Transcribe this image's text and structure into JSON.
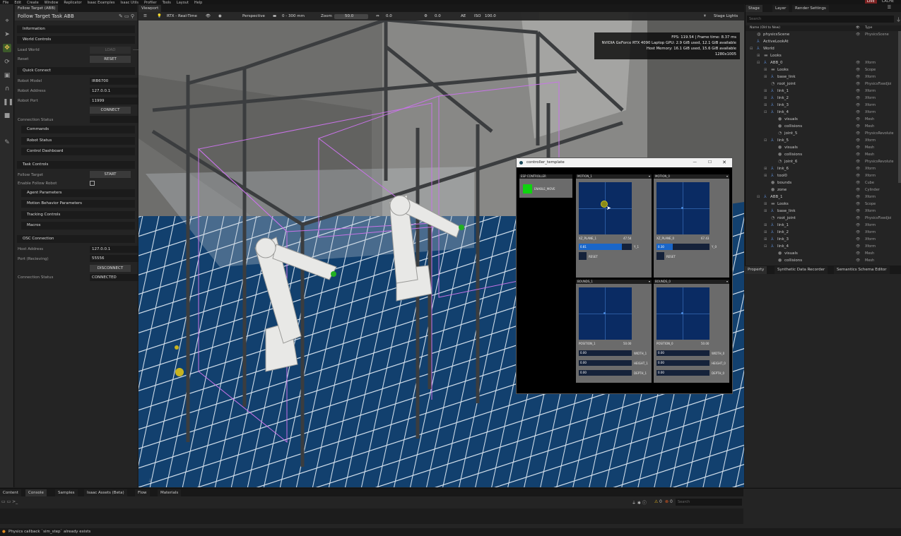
{
  "menu": [
    "File",
    "Edit",
    "Create",
    "Window",
    "Replicator",
    "Isaac Examples",
    "Isaac Utils",
    "Profiler",
    "Tools",
    "Layout",
    "Help"
  ],
  "menu_right": {
    "live": "LIVE",
    "cache": "CACHE"
  },
  "left_panel": {
    "tab": "Follow Target (ABB)",
    "title": "Follow Target Task ABB",
    "sections": {
      "information": "Information",
      "world_controls": "World Controls",
      "quick_connect": "Quick Connect",
      "commands": "Commands",
      "robot_status": "Robot Status",
      "control_dashboard": "Control Dashboard",
      "task_controls": "Task Controls",
      "agent_parameters": "Agent Parameters",
      "motion_behavior": "Motion Behavior Parameters",
      "tracking_controls": "Tracking Controls",
      "macros": "Macros",
      "osc_connection": "OSC Connection"
    },
    "load_world_label": "Load World",
    "load_button": "LOAD",
    "reset_label": "Reset",
    "reset_button": "RESET",
    "robot_model_label": "Robot Model",
    "robot_model": "IRB6700",
    "robot_address_label": "Robot Address",
    "robot_address": "127.0.0.1",
    "robot_port_label": "Robot Port",
    "robot_port": "11999",
    "connect_button": "CONNECT",
    "connection_status_label": "Connection Status",
    "follow_target_label": "Follow Target",
    "start_button": "START",
    "enable_follow_label": "Enable Follow Robot",
    "host_address_label": "Host Address",
    "host_address": "127.0.0.1",
    "port_label": "Port (Recieving)",
    "port": "55556",
    "disconnect_button": "DISCONNECT",
    "osc_status_label": "Connection Status",
    "osc_status": "CONNECTED"
  },
  "viewport": {
    "tab": "Viewport",
    "render_mode": "RTX - Real-Time",
    "camera": "Perspective",
    "lens": "0 - 300 mm",
    "zoom_label": "Zoom",
    "zoom": "50.0",
    "val1": "0.0",
    "val2": "0.0",
    "ae_label": "AE",
    "iso_label": "ISO",
    "iso": "100.0",
    "stage_lights": "Stage Lights",
    "stats": [
      "FPS: 119.54 | Frame time: 8.37 ms",
      "NVIDIA GeForce RTX 4090 Laptop GPU: 2.9 GiB used, 12.1 GiB available",
      "Host Memory: 16.1 GiB used, 15.6 GiB available",
      "1280x1005"
    ]
  },
  "controller": {
    "title": "controller_template",
    "esp": "ESP CONTROLLER",
    "enable_move": "ENABLE_MOVE",
    "panes": [
      {
        "hdr": "MOTION_1",
        "pad_label": "XZ_PLANE_1",
        "pad_val": "47.54",
        "slider": "0.81",
        "slider_fill": 0.81,
        "slider_label": "Y_1",
        "reset": "RESET"
      },
      {
        "hdr": "MOTION_0",
        "pad_label": "XZ_PLANE_0",
        "pad_val": "67.43",
        "slider": "0.30",
        "slider_fill": 0.3,
        "slider_label": "Y_0",
        "reset": "RESET"
      },
      {
        "hdr": "BOUNDS_1",
        "pad_label": "POSITION_1",
        "pad_val": "50.00",
        "f1": "0.00",
        "f1l": "WIDTH_1",
        "f2": "0.00",
        "f2l": "HEIGHT_1",
        "f3": "0.00",
        "f3l": "DEPTH_1"
      },
      {
        "hdr": "BOUNDS_0",
        "pad_label": "POSITION_0",
        "pad_val": "50.00",
        "f1": "0.00",
        "f1l": "WIDTH_0",
        "f2": "0.00",
        "f2l": "HEIGHT_0",
        "f3": "0.00",
        "f3l": "DEPTH_0"
      }
    ]
  },
  "stage": {
    "tabs": [
      "Stage",
      "Layer",
      "Render Settings"
    ],
    "search": "Search",
    "col_name": "Name (Old to New)",
    "col_type": "Type",
    "rows": [
      {
        "name": "physicsScene",
        "type": "PhysicsScene",
        "d": 0,
        "icon": "scene"
      },
      {
        "name": "ActiveLookAt",
        "type": "",
        "d": 0,
        "icon": "xform"
      },
      {
        "name": "World",
        "type": "",
        "d": 0,
        "icon": "xform"
      },
      {
        "name": "Looks",
        "type": "",
        "d": 1,
        "icon": "folder"
      },
      {
        "name": "ABB_0",
        "type": "Xform",
        "d": 1,
        "icon": "xform"
      },
      {
        "name": "Looks",
        "type": "Scope",
        "d": 2,
        "icon": "folder"
      },
      {
        "name": "base_link",
        "type": "Xform",
        "d": 2,
        "icon": "xform"
      },
      {
        "name": "root_joint",
        "type": "PhysicsFixedJoi",
        "d": 2,
        "icon": "joint"
      },
      {
        "name": "link_1",
        "type": "Xform",
        "d": 2,
        "icon": "xform"
      },
      {
        "name": "link_2",
        "type": "Xform",
        "d": 2,
        "icon": "xform"
      },
      {
        "name": "link_3",
        "type": "Xform",
        "d": 2,
        "icon": "xform"
      },
      {
        "name": "link_4",
        "type": "Xform",
        "d": 2,
        "icon": "xform"
      },
      {
        "name": "visuals",
        "type": "Mesh",
        "d": 3,
        "icon": "mesh"
      },
      {
        "name": "collisions",
        "type": "Mesh",
        "d": 3,
        "icon": "mesh"
      },
      {
        "name": "joint_5",
        "type": "PhysicsRevolute",
        "d": 3,
        "icon": "joint"
      },
      {
        "name": "link_5",
        "type": "Xform",
        "d": 2,
        "icon": "xform"
      },
      {
        "name": "visuals",
        "type": "Mesh",
        "d": 3,
        "icon": "mesh"
      },
      {
        "name": "collisions",
        "type": "Mesh",
        "d": 3,
        "icon": "mesh"
      },
      {
        "name": "joint_6",
        "type": "PhysicsRevolute",
        "d": 3,
        "icon": "joint"
      },
      {
        "name": "link_6",
        "type": "Xform",
        "d": 2,
        "icon": "xform"
      },
      {
        "name": "tool0",
        "type": "Xform",
        "d": 2,
        "icon": "xform"
      },
      {
        "name": "bounds",
        "type": "Cube",
        "d": 2,
        "icon": "mesh"
      },
      {
        "name": "zone",
        "type": "Cylinder",
        "d": 2,
        "icon": "mesh"
      },
      {
        "name": "ABB_1",
        "type": "Xform",
        "d": 1,
        "icon": "xform"
      },
      {
        "name": "Looks",
        "type": "Scope",
        "d": 2,
        "icon": "folder"
      },
      {
        "name": "base_link",
        "type": "Xform",
        "d": 2,
        "icon": "xform"
      },
      {
        "name": "root_joint",
        "type": "PhysicsFixedJoi",
        "d": 2,
        "icon": "joint"
      },
      {
        "name": "link_1",
        "type": "Xform",
        "d": 2,
        "icon": "xform"
      },
      {
        "name": "link_2",
        "type": "Xform",
        "d": 2,
        "icon": "xform"
      },
      {
        "name": "link_3",
        "type": "Xform",
        "d": 2,
        "icon": "xform"
      },
      {
        "name": "link_4",
        "type": "Xform",
        "d": 2,
        "icon": "xform"
      },
      {
        "name": "visuals",
        "type": "Mesh",
        "d": 3,
        "icon": "mesh"
      },
      {
        "name": "collisions",
        "type": "Mesh",
        "d": 3,
        "icon": "mesh"
      }
    ]
  },
  "property_tabs": [
    "Property",
    "Synthetic Data Recorder",
    "Semantics Schema Editor"
  ],
  "bottom_tabs": [
    "Content",
    "Console",
    "Samples",
    "Isaac Assets (Beta)",
    "Flow",
    "Materials"
  ],
  "console": {
    "search": "Search",
    "warn_count": "0",
    "err_count": "0"
  },
  "status": "Physics callback `sim_step` already exists"
}
